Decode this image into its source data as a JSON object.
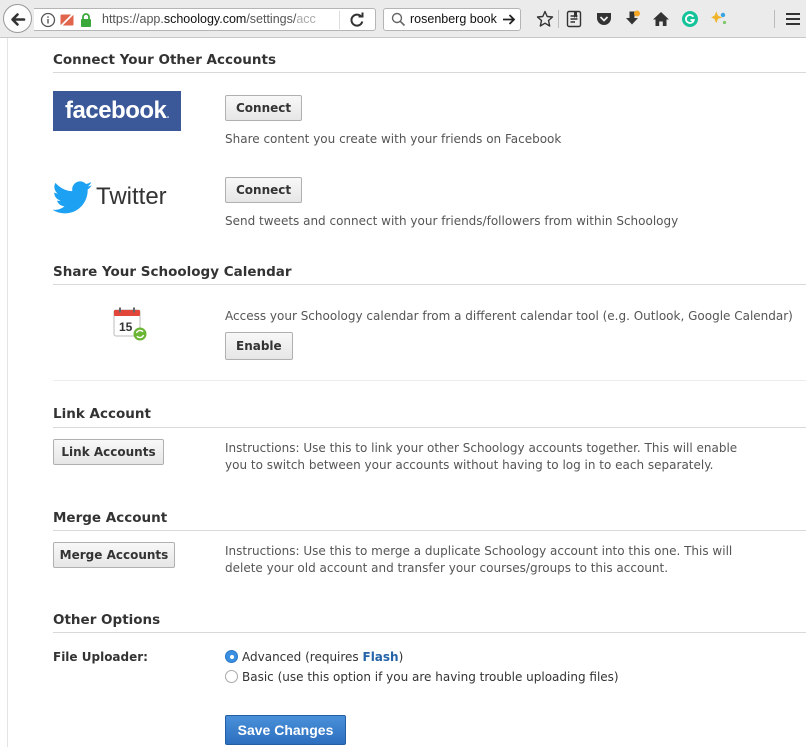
{
  "browser": {
    "url_host_prefix": "https://app.",
    "url_host": "schoology.com",
    "url_path": "/settings/",
    "url_tail": "acc",
    "search_value": "rosenberg book"
  },
  "connect": {
    "title": "Connect Your Other Accounts",
    "facebook": {
      "logo_text": "facebook",
      "button_label": "Connect",
      "description": "Share content you create with your friends on Facebook"
    },
    "twitter": {
      "logo_text": "Twitter",
      "button_label": "Connect",
      "description": "Send tweets and connect with your friends/followers from within Schoology"
    }
  },
  "calendar": {
    "title": "Share Your Schoology Calendar",
    "icon_day": "15",
    "description": "Access your Schoology calendar from a different calendar tool (e.g. Outlook, Google Calendar)",
    "button_label": "Enable"
  },
  "link_account": {
    "title": "Link Account",
    "button_label": "Link Accounts",
    "description_line1": "Instructions: Use this to link your other Schoology accounts together. This will enable",
    "description_line2": "you to switch between your accounts without having to log in to each separately."
  },
  "merge_account": {
    "title": "Merge Account",
    "button_label": "Merge Accounts",
    "description_line1": "Instructions: Use this to merge a duplicate Schoology account into this one. This will",
    "description_line2": "delete your old account and transfer your courses/groups to this account."
  },
  "other_options": {
    "title": "Other Options",
    "file_uploader_label": "File Uploader:",
    "option_advanced_prefix": "Advanced (requires ",
    "option_advanced_link": "Flash",
    "option_advanced_suffix": ")",
    "option_basic": "Basic (use this option if you are having trouble uploading files)",
    "selected": "advanced"
  },
  "save_button_label": "Save Changes",
  "colors": {
    "facebook_blue": "#3b5998",
    "twitter_blue": "#1da1f2",
    "save_blue": "#2c6fbf",
    "radio_blue": "#3b8fe0"
  }
}
